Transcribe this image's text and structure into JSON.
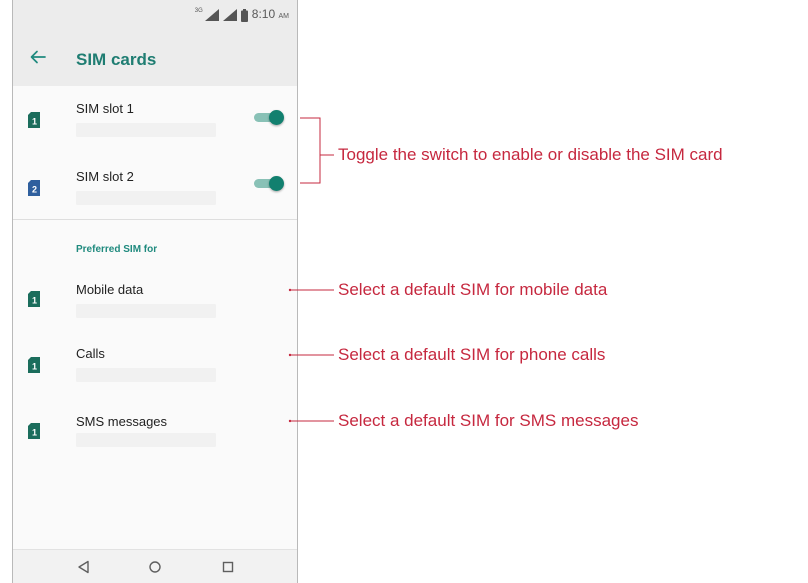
{
  "status_bar": {
    "network_type": "3G",
    "time": "8:10",
    "ampm": "AM"
  },
  "toolbar": {
    "title": "SIM cards"
  },
  "sim_slots": [
    {
      "label": "SIM slot 1",
      "badge": "1",
      "enabled": true,
      "color": "#1b6d5c"
    },
    {
      "label": "SIM slot 2",
      "badge": "2",
      "enabled": true,
      "color": "#2f5f9e"
    }
  ],
  "preferred": {
    "header": "Preferred SIM for",
    "items": [
      {
        "label": "Mobile data",
        "badge": "1"
      },
      {
        "label": "Calls",
        "badge": "1"
      },
      {
        "label": "SMS messages",
        "badge": "1"
      }
    ]
  },
  "callouts": {
    "toggle": "Toggle the switch to enable or disable the SIM card",
    "mobile_data": "Select a default SIM for mobile data",
    "calls": "Select a default SIM for phone calls",
    "sms": "Select a default SIM for SMS messages"
  },
  "colors": {
    "accent": "#1f8a7e",
    "toggle_thumb": "#12806f",
    "toggle_track": "#89c1b6",
    "callout": "#c6283f"
  },
  "icons": {
    "back": "arrow-left-icon",
    "sim": "sim-card-icon",
    "nav_back": "triangle-back-icon",
    "nav_home": "circle-home-icon",
    "nav_recents": "square-recents-icon"
  }
}
